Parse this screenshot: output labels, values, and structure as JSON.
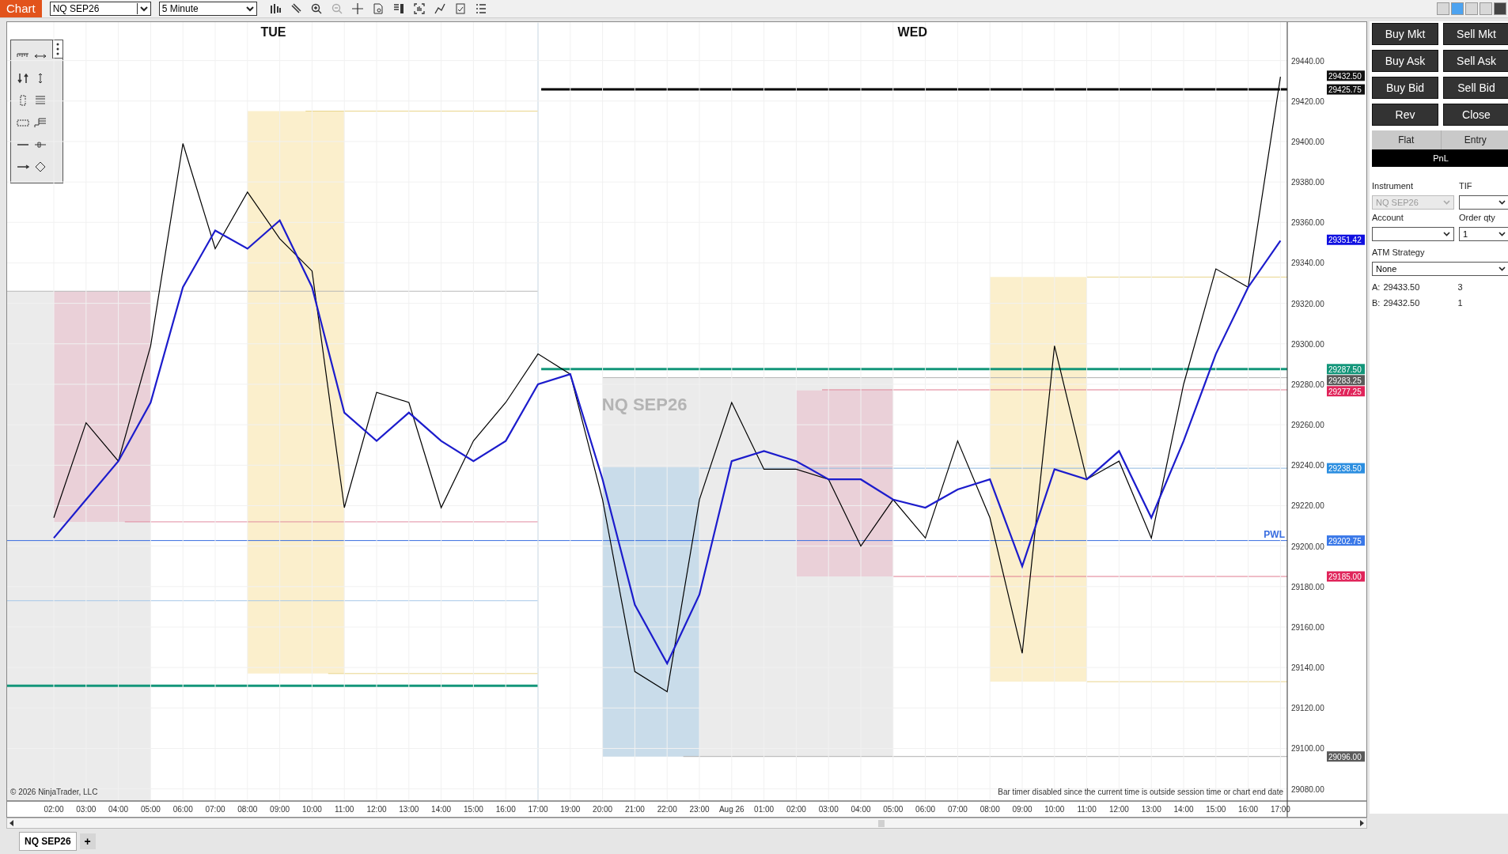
{
  "toolbar": {
    "title": "Chart",
    "instrument": "NQ SEP26",
    "interval": "5 Minute"
  },
  "chart": {
    "chart_data": {
      "type": "line",
      "categories": [
        "02:00",
        "03:00",
        "04:00",
        "05:00",
        "06:00",
        "07:00",
        "08:00",
        "09:00",
        "10:00",
        "11:00",
        "12:00",
        "13:00",
        "14:00",
        "15:00",
        "16:00",
        "17:00",
        "19:00",
        "20:00",
        "21:00",
        "22:00",
        "23:00",
        "Aug 26",
        "01:00",
        "02:00",
        "03:00",
        "04:00",
        "05:00",
        "06:00",
        "07:00",
        "08:00",
        "09:00",
        "10:00",
        "11:00",
        "12:00",
        "13:00",
        "14:00",
        "15:00",
        "16:00",
        "17:00"
      ],
      "series": [
        {
          "color": "#000000",
          "values": [
            29214,
            29261,
            29242,
            29299,
            29399,
            29347,
            29375,
            29352,
            29336,
            29219,
            29276,
            29271,
            29219,
            29252,
            29271,
            29295,
            29285,
            29223,
            29138,
            29128,
            29223,
            29271,
            29238,
            29238,
            29233,
            29200,
            29223,
            29204,
            29252,
            29214,
            29147,
            29299,
            29233,
            29242,
            29204,
            29280,
            29337,
            29328,
            29432
          ]
        },
        {
          "color": "#1c1ccc",
          "values": [
            29204,
            29223,
            29242,
            29271,
            29328,
            29356,
            29347,
            29361,
            29328,
            29266,
            29252,
            29266,
            29252,
            29242,
            29252,
            29280,
            29285,
            29233,
            29171,
            29142,
            29176,
            29242,
            29247,
            29242,
            29233,
            29233,
            29223,
            29219,
            29228,
            29233,
            29190,
            29238,
            29233,
            29247,
            29214,
            29252,
            29295,
            29328,
            29351
          ]
        }
      ],
      "ylim": [
        29074,
        29459
      ],
      "yticks": [
        {
          "value": 29440,
          "label": "29440.00"
        },
        {
          "value": 29420,
          "label": "29420.00"
        },
        {
          "value": 29400,
          "label": "29400.00"
        },
        {
          "value": 29380,
          "label": "29380.00"
        },
        {
          "value": 29360,
          "label": "29360.00"
        },
        {
          "value": 29340,
          "label": "29340.00"
        },
        {
          "value": 29320,
          "label": "29320.00"
        },
        {
          "value": 29300,
          "label": "29300.00"
        },
        {
          "value": 29280,
          "label": "29280.00"
        },
        {
          "value": 29260,
          "label": "29260.00"
        },
        {
          "value": 29240,
          "label": "29240.00"
        },
        {
          "value": 29220,
          "label": "29220.00"
        },
        {
          "value": 29200,
          "label": "29200.00"
        },
        {
          "value": 29180,
          "label": "29180.00"
        },
        {
          "value": 29160,
          "label": "29160.00"
        },
        {
          "value": 29140,
          "label": "29140.00"
        },
        {
          "value": 29120,
          "label": "29120.00"
        },
        {
          "value": 29100,
          "label": "29100.00"
        },
        {
          "value": 29080,
          "label": "29080.00"
        }
      ],
      "grid": true
    },
    "day_labels": [
      "TUE",
      "WED"
    ],
    "level_label": "PWL",
    "watermark": "NQ SEP26",
    "price_markers": [
      {
        "text": "29432.50",
        "color": "#111111"
      },
      {
        "text": "29425.75",
        "color": "#111111"
      },
      {
        "text": "29351.42",
        "color": "#1010e0"
      },
      {
        "text": "29287.50",
        "color": "#13967a"
      },
      {
        "text": "29283.25",
        "color": "#5a5a5a"
      },
      {
        "text": "29277.25",
        "color": "#e0245a"
      },
      {
        "text": "29238.50",
        "color": "#2b8ee0"
      },
      {
        "text": "29202.75",
        "color": "#3a78e8"
      },
      {
        "text": "29185.00",
        "color": "#e0245a"
      },
      {
        "text": "29096.00",
        "color": "#5a5a5a"
      }
    ],
    "copyright": "© 2026 NinjaTrader, LLC",
    "bar_timer": "Bar timer disabled since the current time is outside session time or chart end date"
  },
  "order_panel": {
    "buttons": [
      "Buy Mkt",
      "Sell Mkt",
      "Buy Ask",
      "Sell Ask",
      "Buy Bid",
      "Sell Bid",
      "Rev",
      "Close"
    ],
    "position": "Flat",
    "entry": "Entry",
    "pnl": "PnL",
    "fields": [
      {
        "label": "Instrument",
        "value": "NQ SEP26",
        "disabled": true
      },
      {
        "label": "TIF",
        "disabled": false
      },
      {
        "label": "Account",
        "disabled": false
      },
      {
        "label": "Order qty",
        "value": "1",
        "disabled": false
      }
    ],
    "atm_label": "ATM Strategy",
    "atm_value": "None",
    "quotes": [
      {
        "label": "A:",
        "price": "29433.50",
        "size": "3"
      },
      {
        "label": "B:",
        "price": "29432.50",
        "size": "1"
      }
    ]
  },
  "tabs": [
    {
      "label": "NQ SEP26",
      "selected": true
    }
  ],
  "add_tab": "+"
}
